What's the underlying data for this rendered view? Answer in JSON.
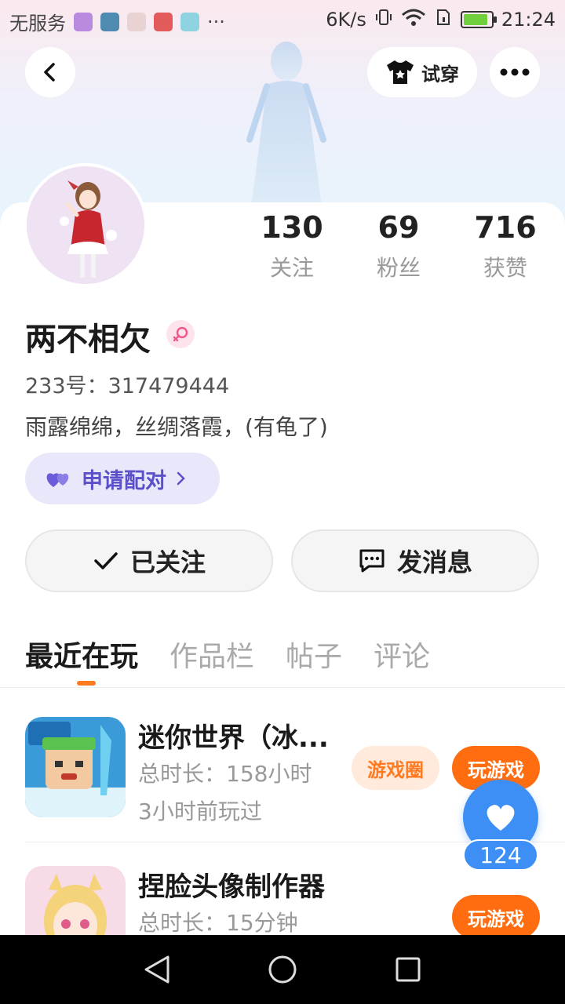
{
  "status_bar": {
    "carrier": "无服务",
    "net_speed": "6K/s",
    "time": "21:24",
    "icons": [
      "vibrate-icon",
      "wifi-icon",
      "sim-icon",
      "battery-icon"
    ]
  },
  "header": {
    "tryon_label": "试穿"
  },
  "stats": [
    {
      "value": "130",
      "label": "关注"
    },
    {
      "value": "69",
      "label": "粉丝"
    },
    {
      "value": "716",
      "label": "获赞"
    }
  ],
  "profile": {
    "name": "两不相欠",
    "gender": "female",
    "uid": "233号：317479444",
    "bio": "雨露绵绵，丝绸落霞，(有龟了)"
  },
  "pair_button": {
    "label": "申请配对",
    "accent": "#5b50c9"
  },
  "actions": {
    "follow_label": "已关注",
    "message_label": "发消息"
  },
  "tabs": [
    {
      "label": "最近在玩",
      "active": true
    },
    {
      "label": "作品栏",
      "active": false
    },
    {
      "label": "帖子",
      "active": false
    },
    {
      "label": "评论",
      "active": false
    }
  ],
  "games": [
    {
      "title": "迷你世界（冰...",
      "duration": "总时长：158小时",
      "last_played": "3小时前玩过",
      "circle_label": "游戏圈",
      "play_label": "玩游戏"
    },
    {
      "title": "捏脸头像制作器",
      "duration": "总时长：15分钟",
      "play_label": "玩游戏"
    }
  ],
  "like_fab": {
    "count": "124"
  },
  "colors": {
    "accent_orange": "#ff6d10",
    "like_blue": "#3d8ff5"
  }
}
